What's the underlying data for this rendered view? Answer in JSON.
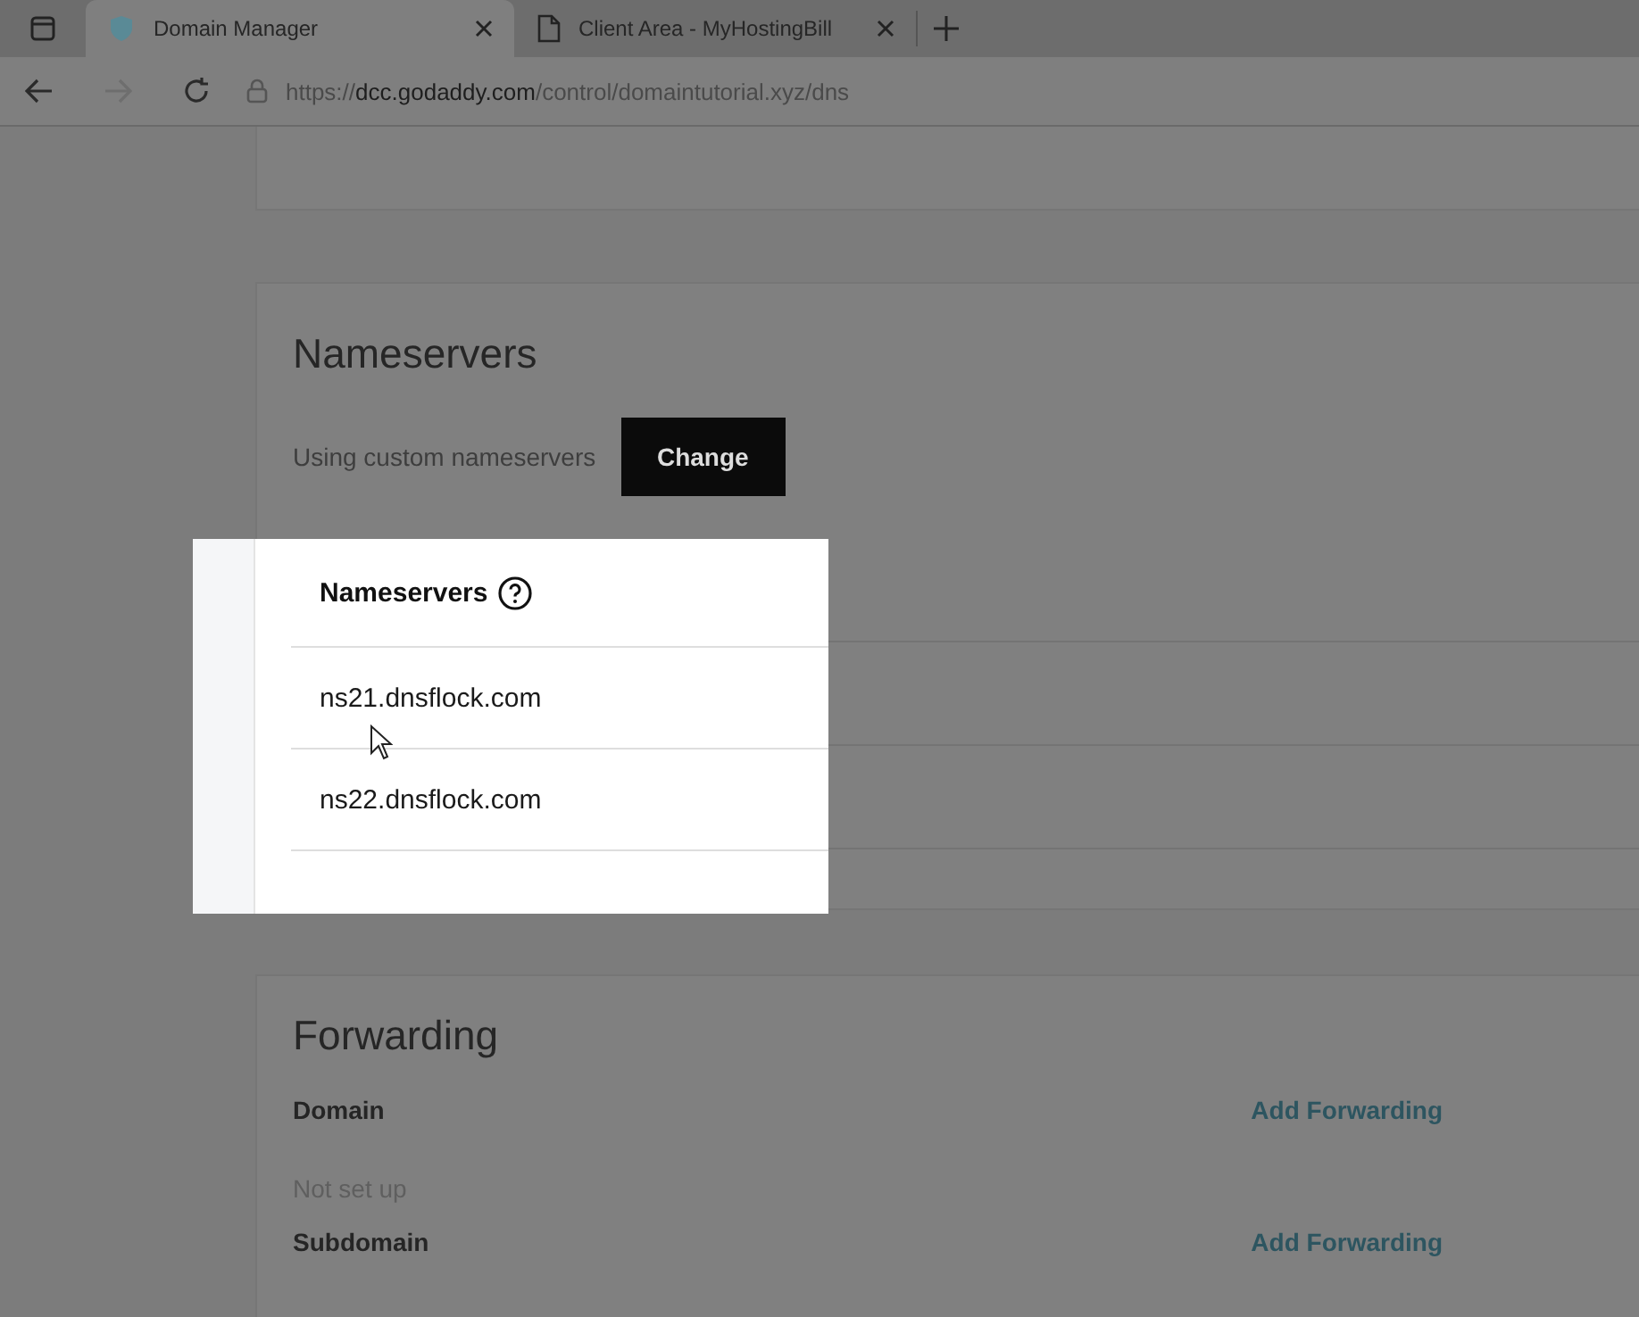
{
  "browser": {
    "tabs": [
      {
        "title": "Domain Manager",
        "kind": "site",
        "selected": true
      },
      {
        "title": "Client Area - MyHostingBill",
        "kind": "page",
        "selected": false
      }
    ],
    "url_host": "dcc.godaddy.com",
    "url_prefix": "https://",
    "url_path": "/control/domaintutorial.xyz/dns"
  },
  "nameservers": {
    "title": "Nameservers",
    "status": "Using custom nameservers",
    "button": "Change",
    "table_heading": "Nameservers",
    "rows": [
      "ns21.dnsflock.com",
      "ns22.dnsflock.com"
    ]
  },
  "forwarding": {
    "title": "Forwarding",
    "items": [
      {
        "label": "Domain",
        "action": "Add Forwarding",
        "status": "Not set up"
      },
      {
        "label": "Subdomain",
        "action": "Add Forwarding"
      }
    ]
  }
}
